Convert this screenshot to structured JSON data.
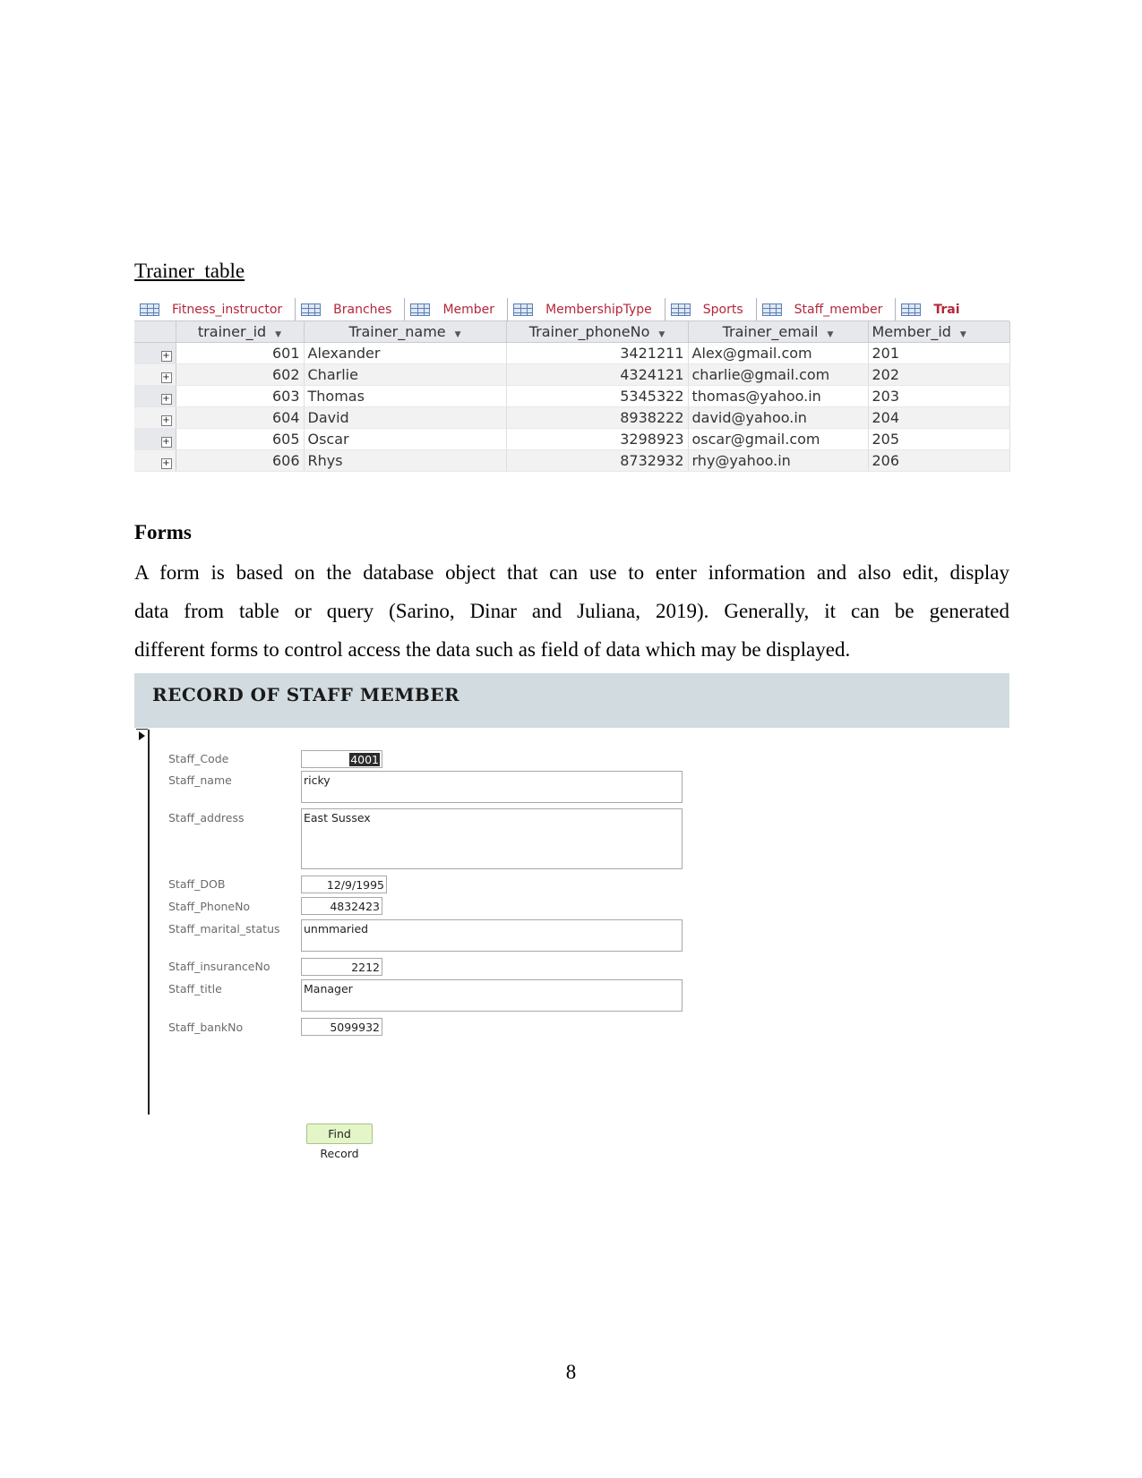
{
  "document": {
    "table_caption": "Trainer_table",
    "section_heading": "Forms",
    "paragraph_lines": [
      "A form is based on the database object that can use to enter information and also edit, display",
      "data from table or query (Sarino, Dinar and Juliana, 2019). Generally, it can be generated",
      "different forms to control access the data such as field of data which may be displayed."
    ],
    "page_number": "8"
  },
  "datasheet": {
    "tabs": [
      {
        "label": "Fitness_instructor"
      },
      {
        "label": "Branches"
      },
      {
        "label": "Member"
      },
      {
        "label": "MembershipType"
      },
      {
        "label": "Sports"
      },
      {
        "label": "Staff_member"
      },
      {
        "label": "Trai"
      }
    ],
    "columns": [
      "trainer_id",
      "Trainer_name",
      "Trainer_phoneNo",
      "Trainer_email",
      "Member_id"
    ],
    "rows": [
      {
        "trainer_id": "601",
        "Trainer_name": "Alexander",
        "Trainer_phoneNo": "3421211",
        "Trainer_email": "Alex@gmail.com",
        "Member_id": "201"
      },
      {
        "trainer_id": "602",
        "Trainer_name": "Charlie",
        "Trainer_phoneNo": "4324121",
        "Trainer_email": "charlie@gmail.com",
        "Member_id": "202"
      },
      {
        "trainer_id": "603",
        "Trainer_name": "Thomas",
        "Trainer_phoneNo": "5345322",
        "Trainer_email": "thomas@yahoo.in",
        "Member_id": "203"
      },
      {
        "trainer_id": "604",
        "Trainer_name": "David",
        "Trainer_phoneNo": "8938222",
        "Trainer_email": "david@yahoo.in",
        "Member_id": "204"
      },
      {
        "trainer_id": "605",
        "Trainer_name": "Oscar",
        "Trainer_phoneNo": "3298923",
        "Trainer_email": "oscar@gmail.com",
        "Member_id": "205"
      },
      {
        "trainer_id": "606",
        "Trainer_name": "Rhys",
        "Trainer_phoneNo": "8732932",
        "Trainer_email": "rhy@yahoo.in",
        "Member_id": "206"
      }
    ]
  },
  "form": {
    "title": "RECORD OF STAFF MEMBER",
    "fields": {
      "staff_code": {
        "label": "Staff_Code",
        "value": "4001"
      },
      "staff_name": {
        "label": "Staff_name",
        "value": "ricky"
      },
      "staff_address": {
        "label": "Staff_address",
        "value": "East Sussex"
      },
      "staff_dob": {
        "label": "Staff_DOB",
        "value": "12/9/1995"
      },
      "staff_phone": {
        "label": "Staff_PhoneNo",
        "value": "4832423"
      },
      "staff_marital": {
        "label": "Staff_marital_status",
        "value": "unmmaried"
      },
      "staff_insurance": {
        "label": "Staff_insuranceNo",
        "value": "2212"
      },
      "staff_title": {
        "label": "Staff_title",
        "value": "Manager"
      },
      "staff_bank": {
        "label": "Staff_bankNo",
        "value": "5099932"
      }
    },
    "find_button_label": "Find Record"
  }
}
